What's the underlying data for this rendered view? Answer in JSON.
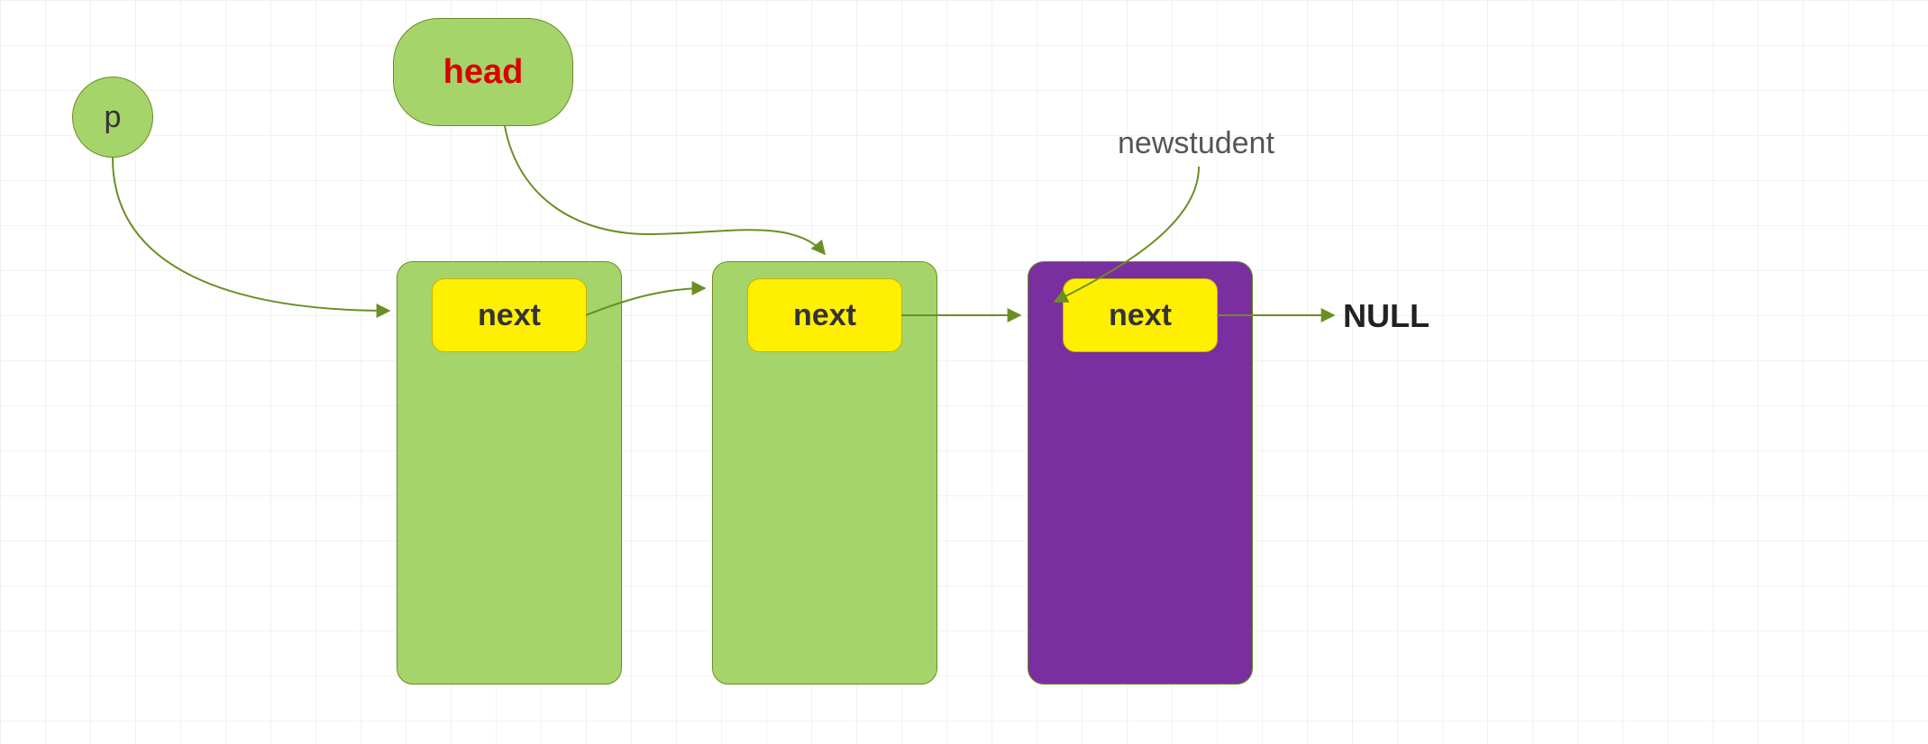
{
  "pointers": {
    "p_label": "p",
    "head_label": "head",
    "newstudent_label": "newstudent"
  },
  "nodes": {
    "node1_next": "next",
    "node2_next": "next",
    "node3_next": "next"
  },
  "terminal": {
    "null_label": "NULL"
  },
  "colors": {
    "node_green": "#a5d46a",
    "node_purple": "#7b2ea0",
    "next_yellow": "#ffef00",
    "outline": "#6b8e23",
    "head_text": "#d80000"
  },
  "chart_data": {
    "type": "diagram",
    "description": "Singly linked list with head, traversal pointer p, and a newly appended node (newstudent).",
    "pointers": [
      {
        "name": "p",
        "points_to": "node1"
      },
      {
        "name": "head",
        "points_to": "node2"
      },
      {
        "name": "newstudent",
        "points_to": "node3"
      }
    ],
    "list": [
      {
        "id": "node1",
        "color": "green",
        "next": "node2"
      },
      {
        "id": "node2",
        "color": "green",
        "next": "node3"
      },
      {
        "id": "node3",
        "color": "purple",
        "next": "NULL"
      }
    ]
  }
}
